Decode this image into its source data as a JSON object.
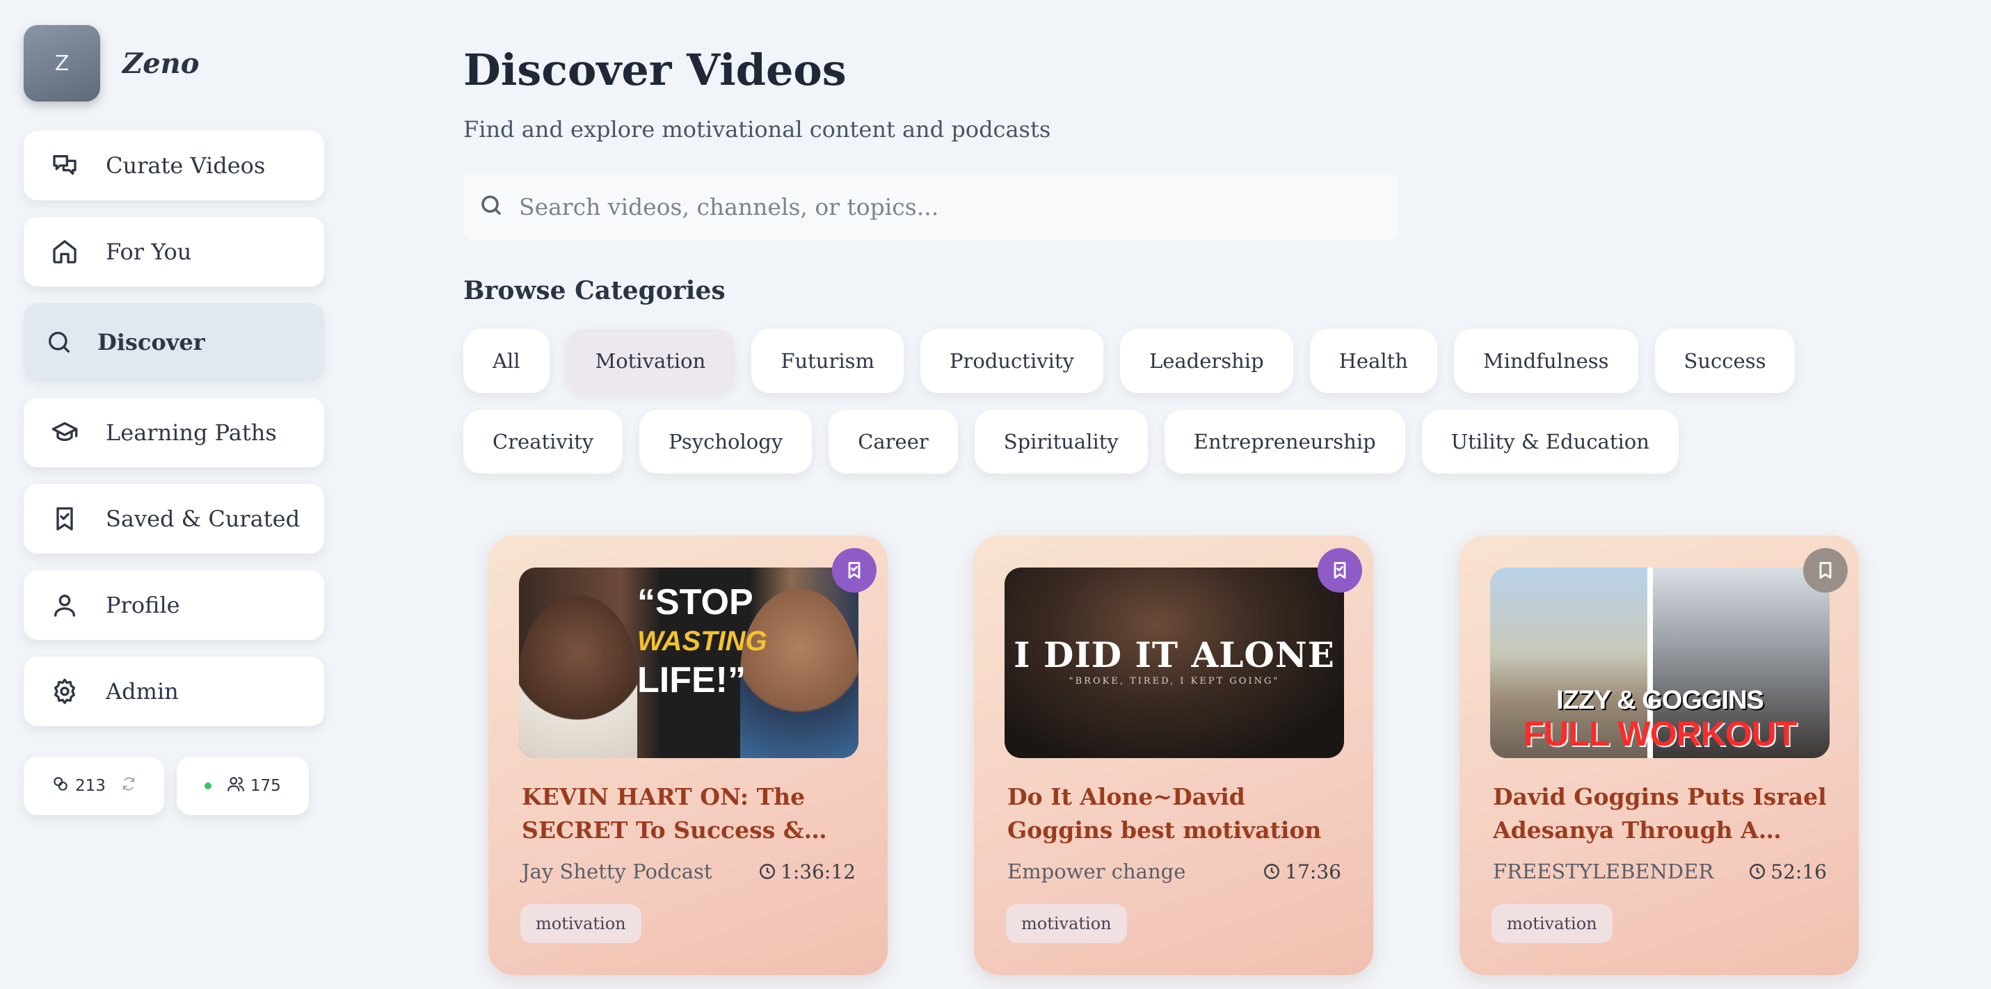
{
  "brand": {
    "logo_letter": "Z",
    "name": "Zeno"
  },
  "sidebar": {
    "items": [
      {
        "label": "Curate Videos",
        "icon": "chat-bubbles-icon"
      },
      {
        "label": "For You",
        "icon": "home-icon"
      },
      {
        "label": "Discover",
        "icon": "search-icon",
        "active": true
      },
      {
        "label": "Learning Paths",
        "icon": "graduation-cap-icon"
      },
      {
        "label": "Saved & Curated",
        "icon": "bookmark-check-icon"
      },
      {
        "label": "Profile",
        "icon": "user-icon"
      },
      {
        "label": "Admin",
        "icon": "gear-icon"
      }
    ],
    "stats": {
      "links_count": "213",
      "users_count": "175"
    }
  },
  "main": {
    "title": "Discover Videos",
    "subtitle": "Find and explore motivational content and podcasts",
    "search": {
      "placeholder": "Search videos, channels, or topics...",
      "value": ""
    },
    "categories_title": "Browse Categories",
    "categories": [
      "All",
      "Motivation",
      "Futurism",
      "Productivity",
      "Leadership",
      "Health",
      "Mindfulness",
      "Success",
      "Creativity",
      "Psychology",
      "Career",
      "Spirituality",
      "Entrepreneurship",
      "Utility & Education"
    ],
    "active_category": "Motivation"
  },
  "videos": [
    {
      "title": "KEVIN HART ON: The SECRET To Success & Happiness...",
      "channel": "Jay Shetty Podcast",
      "duration": "1:36:12",
      "tag": "motivation",
      "thumb_text": [
        "“STOP",
        "WASTING",
        "LIFE!”"
      ],
      "bookmark_color": "#8f5cc7"
    },
    {
      "title": "Do It Alone~David Goggins best motivation",
      "channel": "Empower change",
      "duration": "17:36",
      "tag": "motivation",
      "thumb_text": [
        "I DID IT ALONE",
        "\"BROKE, TIRED, I KEPT GOING\""
      ],
      "bookmark_color": "#8f5cc7"
    },
    {
      "title": "David Goggins Puts Israel Adesanya Through A BRUTAL...",
      "channel": "FREESTYLEBENDER",
      "duration": "52:16",
      "tag": "motivation",
      "thumb_text": [
        "IZZY & GOGGINS",
        "FULL WORKOUT"
      ],
      "bookmark_color": "#9a8f88"
    }
  ]
}
